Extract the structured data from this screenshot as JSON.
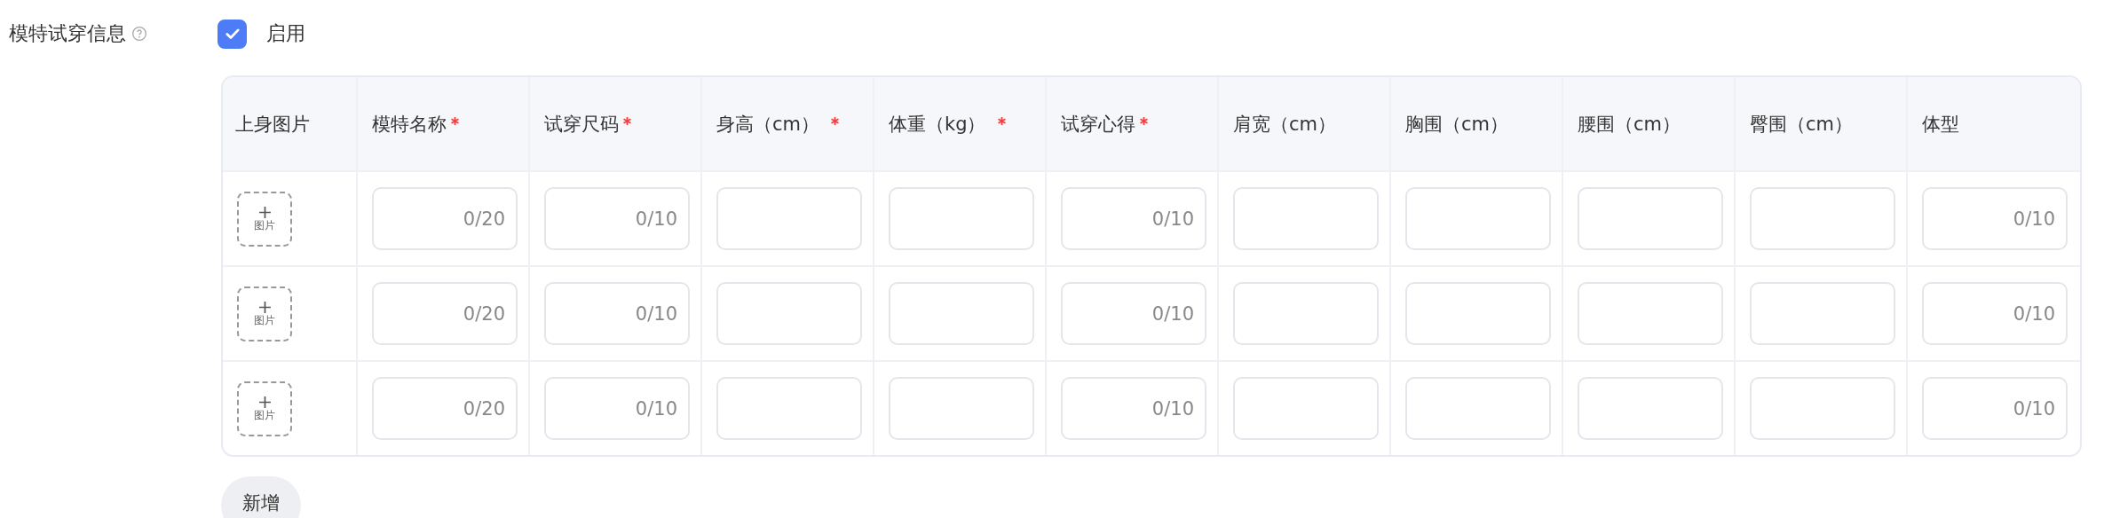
{
  "field": {
    "label": "模特试穿信息",
    "help": true
  },
  "enable": {
    "label": "启用",
    "checked": true
  },
  "table": {
    "columns": [
      {
        "label": "上身图片",
        "required": false
      },
      {
        "label": "模特名称",
        "required": true
      },
      {
        "label": "试穿尺码",
        "required": true
      },
      {
        "label": "身高（cm）",
        "required": true
      },
      {
        "label": "体重（kg）",
        "required": true
      },
      {
        "label": "试穿心得",
        "required": true
      },
      {
        "label": "肩宽（cm）",
        "required": false
      },
      {
        "label": "胸围（cm）",
        "required": false
      },
      {
        "label": "腰围（cm）",
        "required": false
      },
      {
        "label": "臀围（cm）",
        "required": false
      },
      {
        "label": "体型",
        "required": false
      }
    ],
    "rows": [
      {
        "cells": [
          {
            "kind": "upload",
            "label": "图片"
          },
          {
            "kind": "input",
            "counter": "0/20"
          },
          {
            "kind": "input",
            "counter": "0/10"
          },
          {
            "kind": "input"
          },
          {
            "kind": "input"
          },
          {
            "kind": "input",
            "counter": "0/10"
          },
          {
            "kind": "input"
          },
          {
            "kind": "input"
          },
          {
            "kind": "input"
          },
          {
            "kind": "input"
          },
          {
            "kind": "input",
            "counter": "0/10"
          }
        ]
      },
      {
        "cells": [
          {
            "kind": "upload",
            "label": "图片"
          },
          {
            "kind": "input",
            "counter": "0/20"
          },
          {
            "kind": "input",
            "counter": "0/10"
          },
          {
            "kind": "input"
          },
          {
            "kind": "input"
          },
          {
            "kind": "input",
            "counter": "0/10"
          },
          {
            "kind": "input"
          },
          {
            "kind": "input"
          },
          {
            "kind": "input"
          },
          {
            "kind": "input"
          },
          {
            "kind": "input",
            "counter": "0/10"
          }
        ]
      },
      {
        "cells": [
          {
            "kind": "upload",
            "label": "图片"
          },
          {
            "kind": "input",
            "counter": "0/20"
          },
          {
            "kind": "input",
            "counter": "0/10"
          },
          {
            "kind": "input"
          },
          {
            "kind": "input"
          },
          {
            "kind": "input",
            "counter": "0/10"
          },
          {
            "kind": "input"
          },
          {
            "kind": "input"
          },
          {
            "kind": "input"
          },
          {
            "kind": "input"
          },
          {
            "kind": "input",
            "counter": "0/10"
          }
        ]
      }
    ]
  },
  "add_button": "新增"
}
